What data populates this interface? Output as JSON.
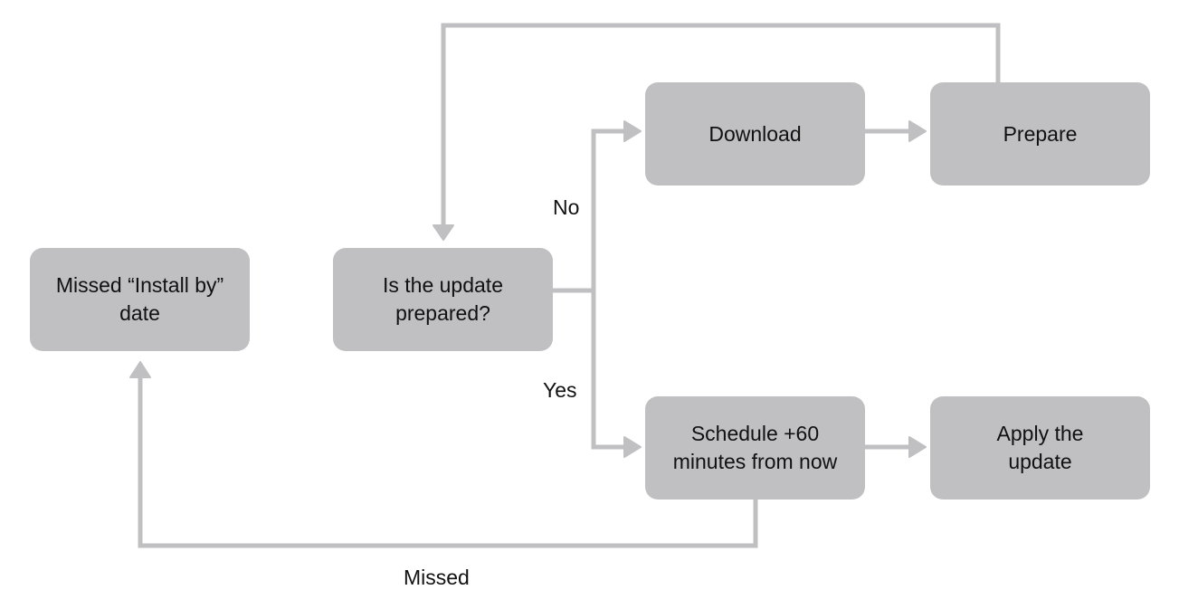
{
  "diagram": {
    "type": "flowchart",
    "colors": {
      "node_fill": "#c0c0c2",
      "connector": "#c0c0c2",
      "text": "#111111",
      "background": "#ffffff"
    },
    "nodes": {
      "missed_install_by": "Missed “Install by”\ndate",
      "is_prepared": "Is the update\nprepared?",
      "download": "Download",
      "prepare": "Prepare",
      "schedule": "Schedule +60\nminutes from now",
      "apply": "Apply the\nupdate"
    },
    "edge_labels": {
      "no": "No",
      "yes": "Yes",
      "missed": "Missed"
    },
    "edges": [
      {
        "from": "is_prepared",
        "to": "download",
        "label": "No"
      },
      {
        "from": "is_prepared",
        "to": "schedule",
        "label": "Yes"
      },
      {
        "from": "download",
        "to": "prepare"
      },
      {
        "from": "prepare",
        "to": "is_prepared"
      },
      {
        "from": "schedule",
        "to": "apply"
      },
      {
        "from": "schedule",
        "to": "missed_install_by",
        "label": "Missed"
      }
    ]
  }
}
